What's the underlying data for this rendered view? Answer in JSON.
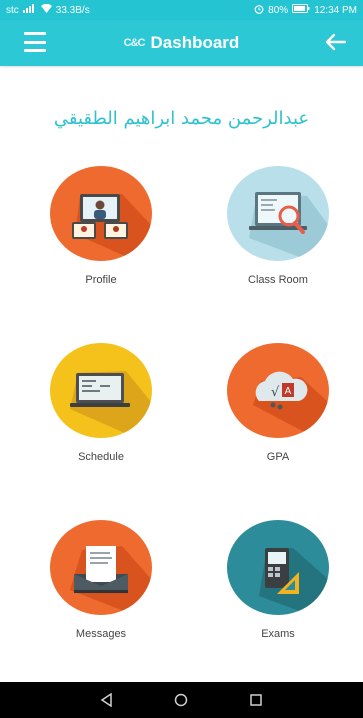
{
  "status_bar": {
    "carrier": "stc",
    "speed": "33.3B/s",
    "battery": "80%",
    "time": "12:34 PM"
  },
  "app_bar": {
    "logo": "C&C",
    "title": "Dashboard"
  },
  "user": {
    "name": "عبدالرحمن محمد ابراهيم الطقيقي"
  },
  "tiles": [
    {
      "label": "Profile",
      "icon": "profile-icon",
      "color": "#ef6a2f"
    },
    {
      "label": "Class Room",
      "icon": "classroom-icon",
      "color": "#b9e0ea"
    },
    {
      "label": "Schedule",
      "icon": "schedule-icon",
      "color": "#f5c21c"
    },
    {
      "label": "GPA",
      "icon": "gpa-icon",
      "color": "#ef6a2f"
    },
    {
      "label": "Messages",
      "icon": "messages-icon",
      "color": "#ef6a2f"
    },
    {
      "label": "Exams",
      "icon": "exams-icon",
      "color": "#2c8c99"
    }
  ],
  "colors": {
    "primary": "#2cc8d6",
    "status": "#24c4d3",
    "orange": "#ef6a2f",
    "yellow": "#f5c21c",
    "teal": "#2c8c99",
    "lightblue": "#b9e0ea"
  }
}
